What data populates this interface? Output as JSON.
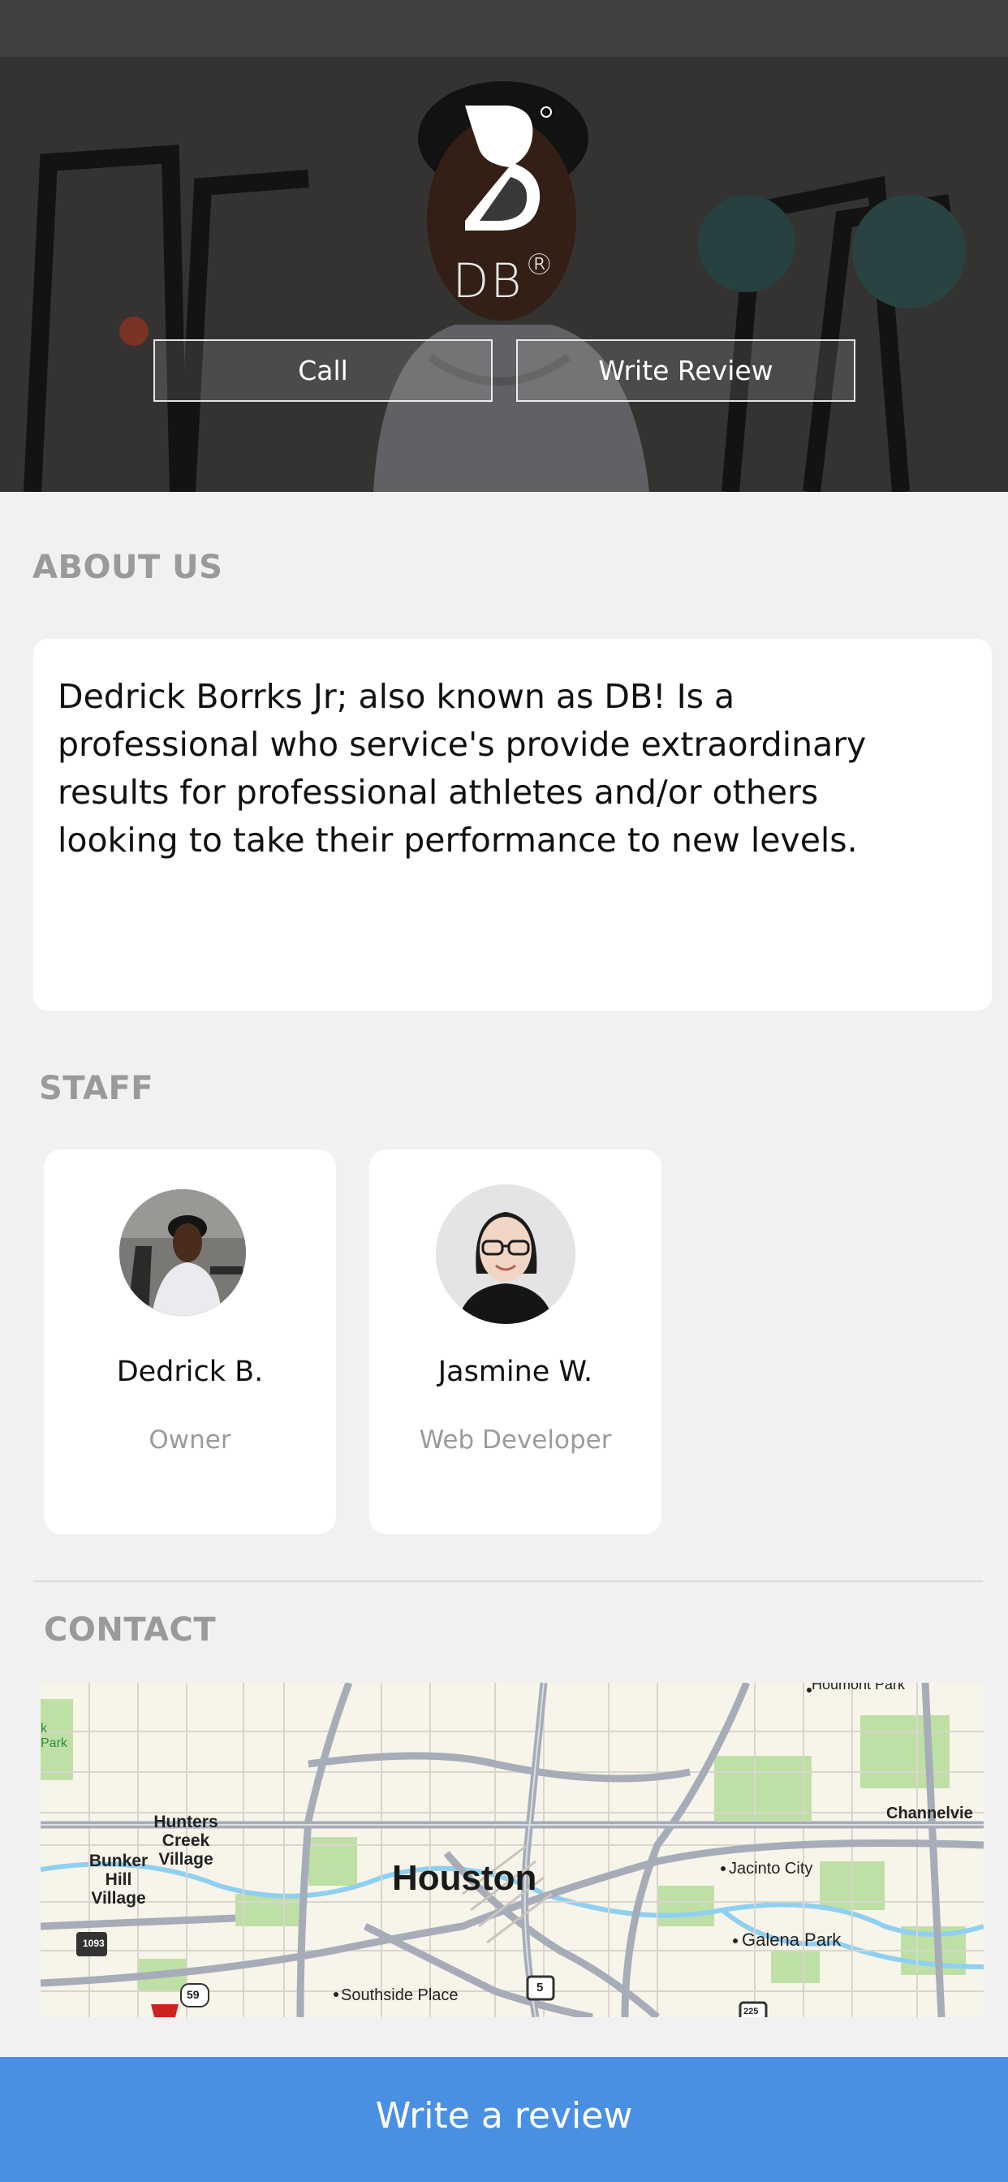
{
  "hero": {
    "brand_name": "DB",
    "brand_mark": "®",
    "call_label": "Call",
    "write_review_label": "Write Review"
  },
  "about": {
    "title": "ABOUT US",
    "text": "Dedrick Borrks Jr; also known as DB! Is a professional who service's provide extraordinary results for professional athletes and/or others looking to take their performance to new levels."
  },
  "staff": {
    "title": "STAFF",
    "members": [
      {
        "name": "Dedrick B.",
        "role": "Owner"
      },
      {
        "name": "Jasmine W.",
        "role": "Web Developer"
      }
    ]
  },
  "contact": {
    "title": "CONTACT",
    "map": {
      "city": "Houston",
      "places": {
        "hunters_creek": "Hunters Creek Village",
        "bunker_hill": "Bunker Hill Village",
        "jacinto_city": "Jacinto City",
        "galena_park": "Galena Park",
        "channelview": "Channelvie",
        "southside_place": "Southside Place",
        "houmont_park": "Houmont Park",
        "park_fragment": "k Park"
      },
      "shields": {
        "fm1093": "1093",
        "us59": "59",
        "i5": "5",
        "sh225": "225"
      }
    }
  },
  "bottom_bar": {
    "label": "Write a review"
  },
  "colors": {
    "accent": "#4a90e2",
    "muted_text": "#9a9a9a",
    "background": "#f1f1f1"
  }
}
